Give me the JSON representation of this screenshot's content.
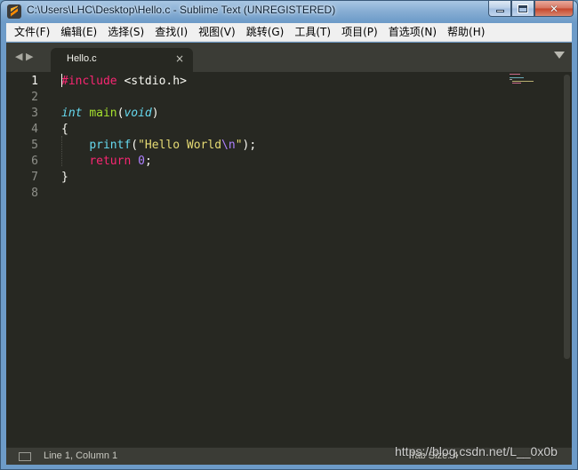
{
  "window": {
    "title": "C:\\Users\\LHC\\Desktop\\Hello.c - Sublime Text (UNREGISTERED)",
    "app_icon": "sublime-text-icon",
    "controls": {
      "minimize": "minimize-icon",
      "maximize": "maximize-icon",
      "close_glyph": "✕"
    }
  },
  "menu": {
    "items": [
      {
        "label": "文件(F)"
      },
      {
        "label": "编辑(E)"
      },
      {
        "label": "选择(S)"
      },
      {
        "label": "查找(I)"
      },
      {
        "label": "视图(V)"
      },
      {
        "label": "跳转(G)"
      },
      {
        "label": "工具(T)"
      },
      {
        "label": "项目(P)"
      },
      {
        "label": "首选项(N)"
      },
      {
        "label": "帮助(H)"
      }
    ]
  },
  "tabs": {
    "nav_left": "◀",
    "nav_right": "▶",
    "active": {
      "label": "Hello.c",
      "close": "×"
    }
  },
  "editor": {
    "line_numbers": [
      "1",
      "2",
      "3",
      "4",
      "5",
      "6",
      "7",
      "8"
    ],
    "active_line": 1,
    "lines": [
      {
        "tokens": [
          {
            "t": "#include",
            "c": "kw-pink"
          },
          {
            "t": " <stdio.h>",
            "c": ""
          }
        ]
      },
      {
        "tokens": []
      },
      {
        "tokens": [
          {
            "t": "int",
            "c": "kw-type"
          },
          {
            "t": " ",
            "c": ""
          },
          {
            "t": "main",
            "c": "fn-green"
          },
          {
            "t": "(",
            "c": ""
          },
          {
            "t": "void",
            "c": "kw-type"
          },
          {
            "t": ")",
            "c": ""
          }
        ]
      },
      {
        "tokens": [
          {
            "t": "{",
            "c": ""
          }
        ]
      },
      {
        "tokens": [
          {
            "t": "    ",
            "c": ""
          },
          {
            "t": "printf",
            "c": "kw-type-plain"
          },
          {
            "t": "(",
            "c": ""
          },
          {
            "t": "\"Hello World",
            "c": "str-yellow"
          },
          {
            "t": "\\n",
            "c": "esc-purple"
          },
          {
            "t": "\"",
            "c": "str-yellow"
          },
          {
            "t": ");",
            "c": ""
          }
        ]
      },
      {
        "tokens": [
          {
            "t": "    ",
            "c": ""
          },
          {
            "t": "return",
            "c": "kw-pink"
          },
          {
            "t": " ",
            "c": ""
          },
          {
            "t": "0",
            "c": "num-purple"
          },
          {
            "t": ";",
            "c": ""
          }
        ]
      },
      {
        "tokens": [
          {
            "t": "}",
            "c": ""
          }
        ]
      },
      {
        "tokens": []
      }
    ]
  },
  "status": {
    "position": "Line 1, Column 1",
    "right_text": "Tab Size: 4"
  },
  "watermark": "https://blog.csdn.net/L__0x0b",
  "colors": {
    "editor_bg": "#272822",
    "pink": "#f92672",
    "cyan": "#66d9ef",
    "green": "#a6e22e",
    "yellow": "#e6db74",
    "purple": "#ae81ff"
  }
}
